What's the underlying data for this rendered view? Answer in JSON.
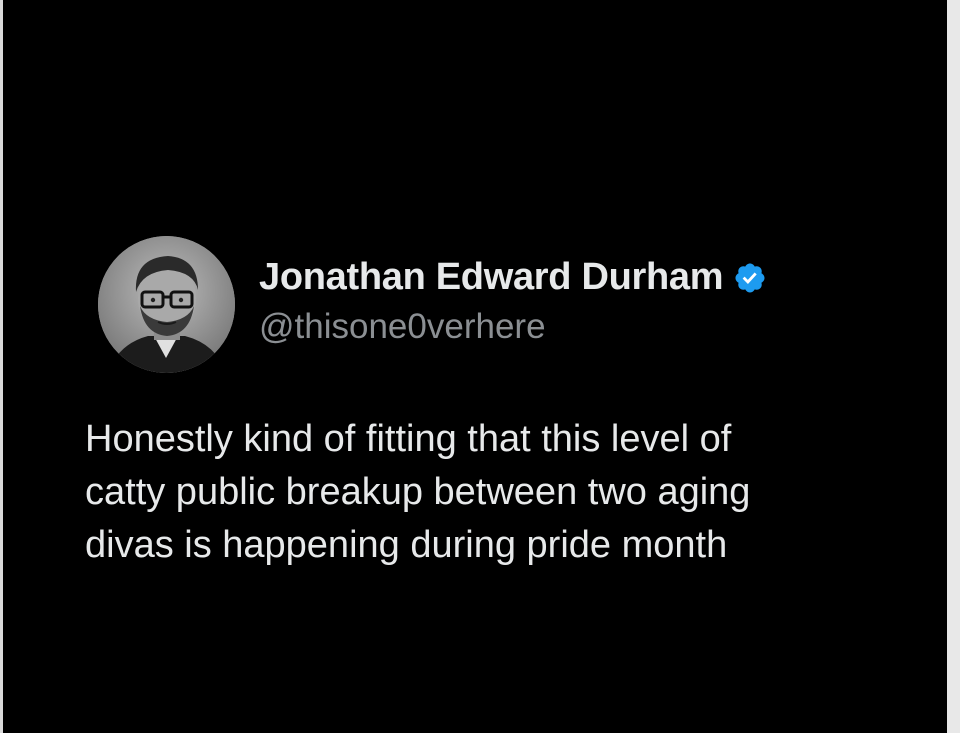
{
  "tweet": {
    "display_name": "Jonathan Edward Durham",
    "handle": "@thisone0verhere",
    "verified_icon": "verified-badge-icon",
    "text_lines": [
      "Honestly kind of fitting that this level of",
      "catty public breakup between two aging",
      "divas is happening during pride month"
    ]
  },
  "colors": {
    "background": "#000000",
    "name": "#e7e9ea",
    "handle": "#8b8f93",
    "verified": "#1d9bf0"
  }
}
